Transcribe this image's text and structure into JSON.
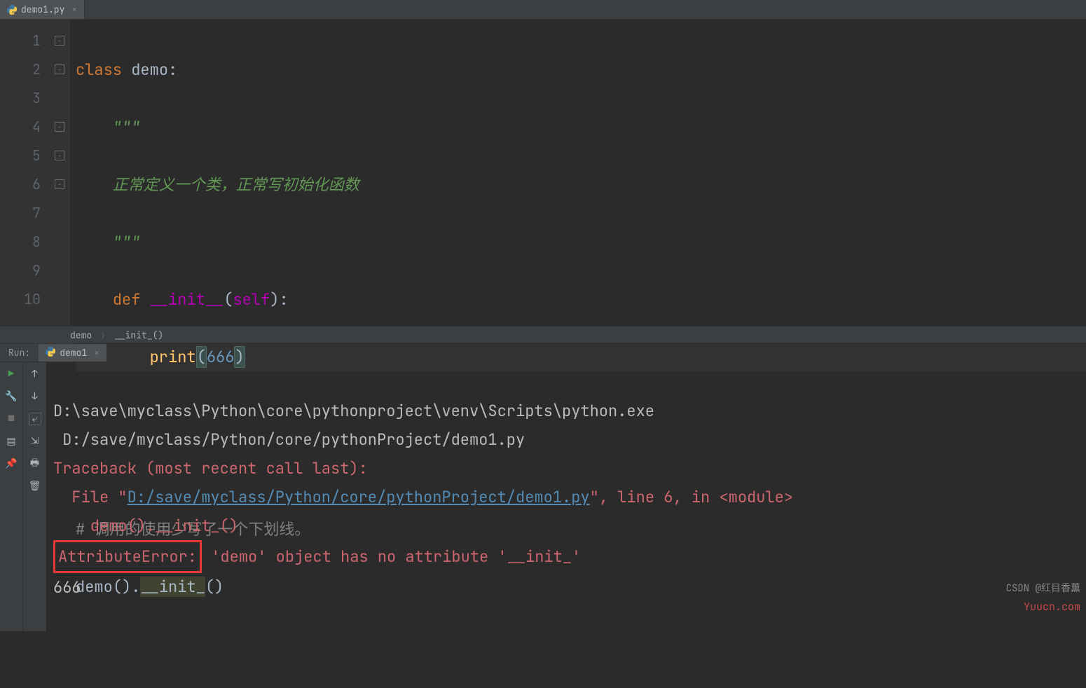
{
  "tab": {
    "filename": "demo1.py"
  },
  "lines": [
    "1",
    "2",
    "3",
    "4",
    "5",
    "6",
    "7",
    "8",
    "9",
    "10"
  ],
  "code": {
    "l1": {
      "kw": "class",
      "name": "demo",
      "colon": ":"
    },
    "l2": "    \"\"\"",
    "l3": "    正常定义一个类，正常写初始化函数",
    "l4": "    \"\"\"",
    "l5": {
      "kw": "def",
      "fn": "__init__",
      "lp": "(",
      "param": "self",
      "rp": ")",
      "colon": ":"
    },
    "l6": {
      "fn": "print",
      "lp": "(",
      "num": "666",
      "rp": ")"
    },
    "l9": "# 调用的使用少写了一个下划线。",
    "l10": {
      "cls": "demo",
      "call": "__init_"
    }
  },
  "breadcrumb": {
    "a": "demo",
    "b": "__init_()"
  },
  "run": {
    "label": "Run:",
    "tab": "demo1",
    "exe": "D:\\save\\myclass\\Python\\core\\pythonproject\\venv\\Scripts\\python.exe",
    "script": " D:/save/myclass/Python/core/pythonProject/demo1.py",
    "tb": "Traceback (most recent call last):",
    "file_pre": "  File \"",
    "file_link": "D:/save/myclass/Python/core/pythonProject/demo1.py",
    "file_post": "\", line 6, in <module>",
    "err_line": "    demo().__init_()",
    "err_name": "AttributeError:",
    "err_msg": " 'demo' object has no attribute '__init_'",
    "out": "666"
  },
  "watermark1": "CSDN @红目香薰",
  "watermark2": "Yuucn.com"
}
